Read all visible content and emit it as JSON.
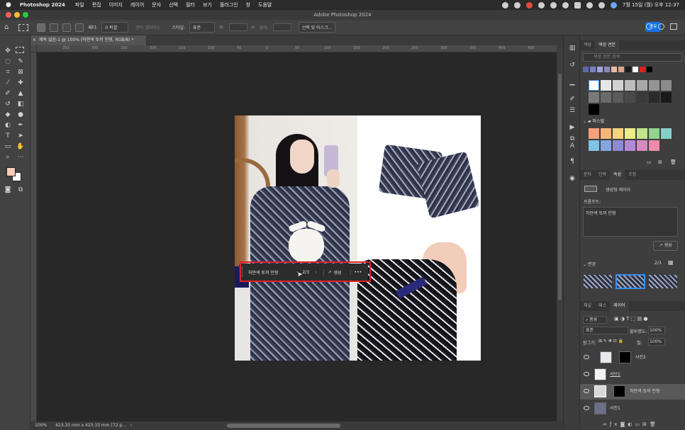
{
  "menubar": {
    "app": "Photoshop 2024",
    "items": [
      "파일",
      "편집",
      "이미지",
      "레이어",
      "문자",
      "선택",
      "필터",
      "보기",
      "플러그인",
      "창",
      "도움말"
    ],
    "datetime": "7월 15일 (월) 오후 12:37"
  },
  "window": {
    "title": "Adobe Photoshop 2024"
  },
  "options": {
    "feather_label": "페더:",
    "feather_value": "0 픽셀",
    "antialias": "앤티 앨리어스",
    "style_label": "스타일:",
    "style_value": "표준",
    "width_label": "폭:",
    "height_label": "높이:",
    "select_mask": "선택 및 마스크...",
    "share": "공유"
  },
  "document": {
    "tab": "제목 없음-1 @ 100% (하얀색 토끼 인형, RGB/8) *",
    "ruler_ticks": [
      "350",
      "300",
      "250",
      "200",
      "150",
      "100",
      "50",
      "0",
      "50",
      "100",
      "150",
      "200",
      "250",
      "300",
      "350",
      "400",
      "450",
      "500",
      "550",
      "600",
      "650",
      "700",
      "750"
    ]
  },
  "status": {
    "zoom": "100%",
    "info": "423.33 mm x 423.33 mm (72 p..."
  },
  "contextbar": {
    "prompt": "하얀색 토끼 인형",
    "counter": "2/3",
    "generate": "생성"
  },
  "swatches": {
    "tabs": [
      "색상",
      "색상 견본"
    ],
    "search_placeholder": "색상 견본 검색",
    "recent": [
      "#5d65b5",
      "#7a7fc0",
      "#9fa4d8",
      "#8a88b8",
      "#e9b8a8",
      "#d9a58a",
      "#1a1a1a",
      "#ffffff",
      "#e02020",
      "#000000"
    ],
    "folder_label": "파스텔",
    "pastel": [
      "#f4a27a",
      "#f7b77c",
      "#f9d27e",
      "#e9ee86",
      "#c3e58a",
      "#93d28e",
      "#84cfc6",
      "#7fc4e6",
      "#84a6e0",
      "#8f8ad8",
      "#b48ad8",
      "#d68ac2",
      "#f08aa8"
    ]
  },
  "properties": {
    "tabs": [
      "문자",
      "단락",
      "속성",
      "조정"
    ],
    "layer_type": "생성형 레이어",
    "prompt_label": "프롬프트:",
    "prompt_value": "하얀색 토끼 인형",
    "generate": "생성",
    "variations_label": "변경",
    "variations_counter": "2/3"
  },
  "layers": {
    "tabs": [
      "채널",
      "패스",
      "레이어"
    ],
    "filter": "종류",
    "blend_mode": "표준",
    "opacity_label": "불투명도:",
    "opacity_value": "100%",
    "lock_label": "잠그기:",
    "fill_label": "칠:",
    "fill_value": "100%",
    "items": [
      {
        "name": "사진2"
      },
      {
        "name": "서브1"
      },
      {
        "name": "하얀색 토끼 인형"
      },
      {
        "name": "사진1"
      }
    ]
  }
}
